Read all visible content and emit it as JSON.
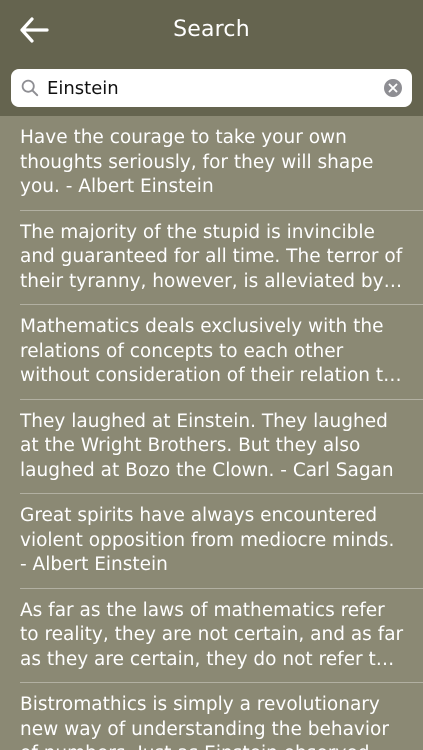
{
  "header": {
    "back_icon": "arrow-left-icon",
    "title": "Search"
  },
  "search": {
    "query": "Einstein",
    "search_icon": "search-icon",
    "clear_icon": "clear-icon"
  },
  "results": [
    {
      "text": "Have the courage to take your own thoughts seriously, for they will shape you. - Albert Einstein"
    },
    {
      "text": "The majority of the stupid is invincible and guaranteed for all time. The terror of their tyranny, however, is alleviated by their lack of consistency. - Albert Einstein"
    },
    {
      "text": "Mathematics deals exclusively with the relations of concepts to each other without consideration of their relation to experience. - Albert Einstein"
    },
    {
      "text": "They laughed at Einstein. They laughed at the Wright Brothers. But they also laughed at Bozo the Clown. - Carl Sagan"
    },
    {
      "text": "Great spirits have always encountered violent opposition from mediocre minds. - Albert Einstein"
    },
    {
      "text": "As far as the laws of mathematics refer to reality, they are not certain, and as far as they are certain, they do not refer to reality. - Albert Einstein"
    },
    {
      "text": "Bistromathics is simply a revolutionary new way of understanding the behavior of numbers. Just as Einstein observed that space was not an absolute but depended on the observer's movement in space - Douglas Adams"
    }
  ],
  "colors": {
    "header_bg": "#65644f",
    "list_bg": "#8b8974",
    "separator": "#b2b0a2",
    "text": "#ffffff"
  }
}
